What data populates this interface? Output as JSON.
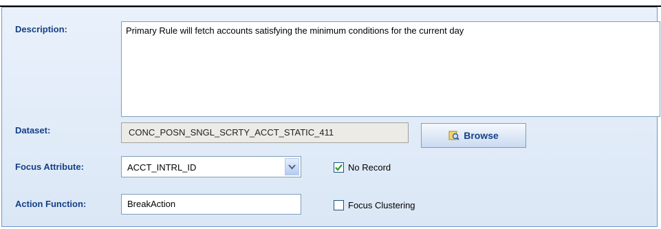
{
  "form": {
    "description_label": "Description:",
    "description_value": "Primary Rule will fetch accounts satisfying the minimum conditions  for the current day",
    "dataset_label": "Dataset:",
    "dataset_value": "CONC_POSN_SNGL_SCRTY_ACCT_STATIC_411",
    "browse_label": "Browse",
    "focus_attribute_label": "Focus Attribute:",
    "focus_attribute_value": "ACCT_INTRL_ID",
    "action_function_label": "Action Function:",
    "action_function_value": "BreakAction",
    "no_record_label": "No Record",
    "no_record_checked": true,
    "focus_clustering_label": "Focus Clustering",
    "focus_clustering_checked": false
  },
  "icons": {
    "browse": "browse-search-icon",
    "dropdown": "chevron-down-icon",
    "check": "checkmark-icon"
  },
  "colors": {
    "label": "#143f86",
    "panel_bg": "#e2ecf9",
    "border": "#7f9db9",
    "check_green": "#21a121"
  }
}
